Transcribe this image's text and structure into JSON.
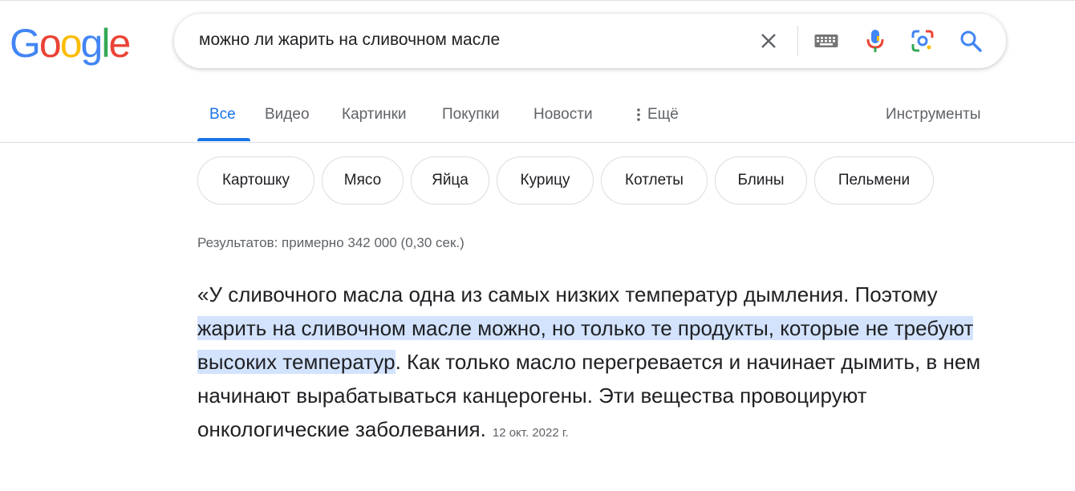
{
  "logo": {
    "letters": [
      "G",
      "o",
      "o",
      "g",
      "l",
      "e"
    ],
    "colors": [
      "#4285F4",
      "#EA4335",
      "#FBBC05",
      "#4285F4",
      "#34A853",
      "#EA4335"
    ]
  },
  "search": {
    "query": "можно ли жарить на сливочном масле",
    "icons": [
      "close-icon",
      "keyboard-icon",
      "microphone-icon",
      "lens-icon",
      "search-icon"
    ]
  },
  "tabs": [
    "Все",
    "Видео",
    "Картинки",
    "Покупки",
    "Новости",
    "Ещё"
  ],
  "tools_label": "Инструменты",
  "chips": [
    "Картошку",
    "Мясо",
    "Яйца",
    "Курицу",
    "Котлеты",
    "Блины",
    "Пельмени"
  ],
  "stats": "Результатов: примерно 342 000 (0,30 сек.)",
  "snippet": {
    "before": "«У сливочного масла одна из самых низких температур дымления. Поэтому ",
    "highlight": "жарить на сливочном масле можно, но только те продукты, которые не требуют высоких температур",
    "after": ". Как только масло перегревается и начинает дымить, в нем начинают вырабатываться канцерогены. Эти вещества провоцируют онкологические заболевания.",
    "date": "12 окт. 2022 г."
  },
  "colors": {
    "accent": "#1a73e8",
    "highlight": "#d3e3fd",
    "muted": "#5f6368"
  }
}
